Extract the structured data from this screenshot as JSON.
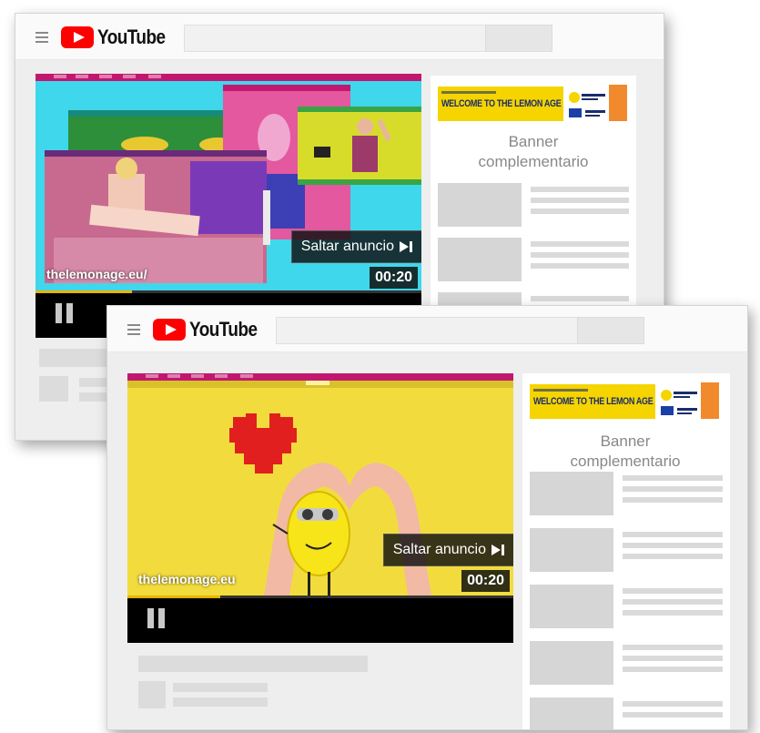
{
  "screens": [
    {
      "app": {
        "logo_text": "YouTube"
      },
      "player": {
        "skip_label": "Saltar anuncio",
        "timer": "00:20",
        "url_overlay": "thelemonage.eu/",
        "progress": 0.25
      },
      "sidebar": {
        "ad_headline": "WELCOME TO THE LEMON AGE",
        "banner_line1": "Banner",
        "banner_line2": "complementario"
      }
    },
    {
      "app": {
        "logo_text": "YouTube"
      },
      "player": {
        "skip_label": "Saltar anuncio",
        "timer": "00:20",
        "url_overlay": "thelemonage.eu",
        "progress": 0.24
      },
      "sidebar": {
        "ad_headline": "WELCOME TO THE LEMON AGE",
        "banner_line1": "Banner",
        "banner_line2": "complementario"
      }
    }
  ],
  "colors": {
    "youtube_red": "#ff0000",
    "menubar_magenta": "#c2176f",
    "progress_yellow": "#e8b400",
    "ad_yellow": "#f5d400"
  },
  "icons": [
    "hamburger-icon",
    "youtube-play-icon",
    "pause-icon",
    "skip-next-icon",
    "heart-icon"
  ]
}
